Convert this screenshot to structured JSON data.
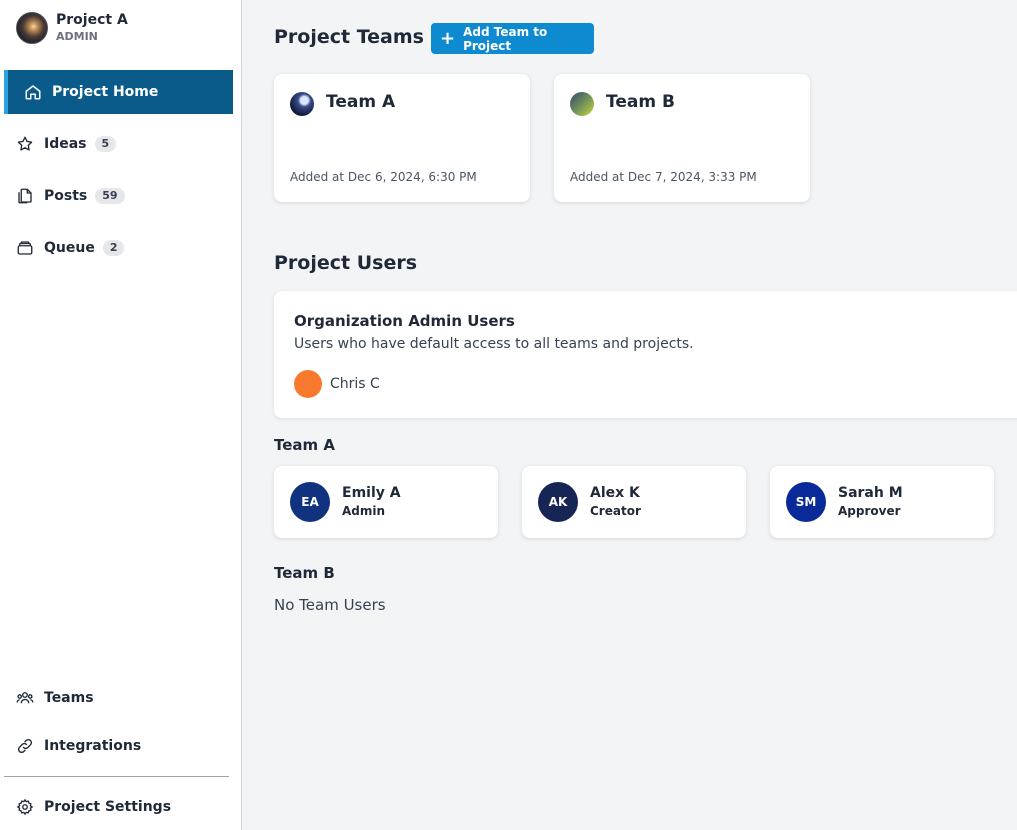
{
  "sidebar": {
    "project_name": "Project A",
    "project_role": "ADMIN",
    "nav": {
      "home": "Project Home",
      "ideas": "Ideas",
      "ideas_count": "5",
      "posts": "Posts",
      "posts_count": "59",
      "queue": "Queue",
      "queue_count": "2",
      "teams": "Teams",
      "integrations": "Integrations",
      "settings": "Project Settings"
    }
  },
  "main": {
    "project_teams_title": "Project Teams",
    "add_team_button": "Add Team to Project",
    "teams": [
      {
        "name": "Team A",
        "added": "Added at Dec 6, 2024, 6:30 PM"
      },
      {
        "name": "Team B",
        "added": "Added at Dec 7, 2024, 3:33 PM"
      }
    ],
    "project_users_title": "Project Users",
    "org_admins": {
      "title": "Organization Admin Users",
      "description": "Users who have default access to all teams and projects.",
      "user": "Chris C"
    },
    "team_a": {
      "title": "Team A",
      "users": [
        {
          "initials": "EA",
          "name": "Emily A",
          "role": "Admin",
          "color": "#11337f"
        },
        {
          "initials": "AK",
          "name": "Alex K",
          "role": "Creator",
          "color": "#172554"
        },
        {
          "initials": "SM",
          "name": "Sarah M",
          "role": "Approver",
          "color": "#0b2a99"
        }
      ]
    },
    "team_b": {
      "title": "Team B",
      "empty_text": "No Team Users"
    }
  },
  "colors": {
    "accent": "#0e8ad1",
    "active_nav": "#0b5b8a",
    "org_user_avatar": "#f97a2f"
  }
}
